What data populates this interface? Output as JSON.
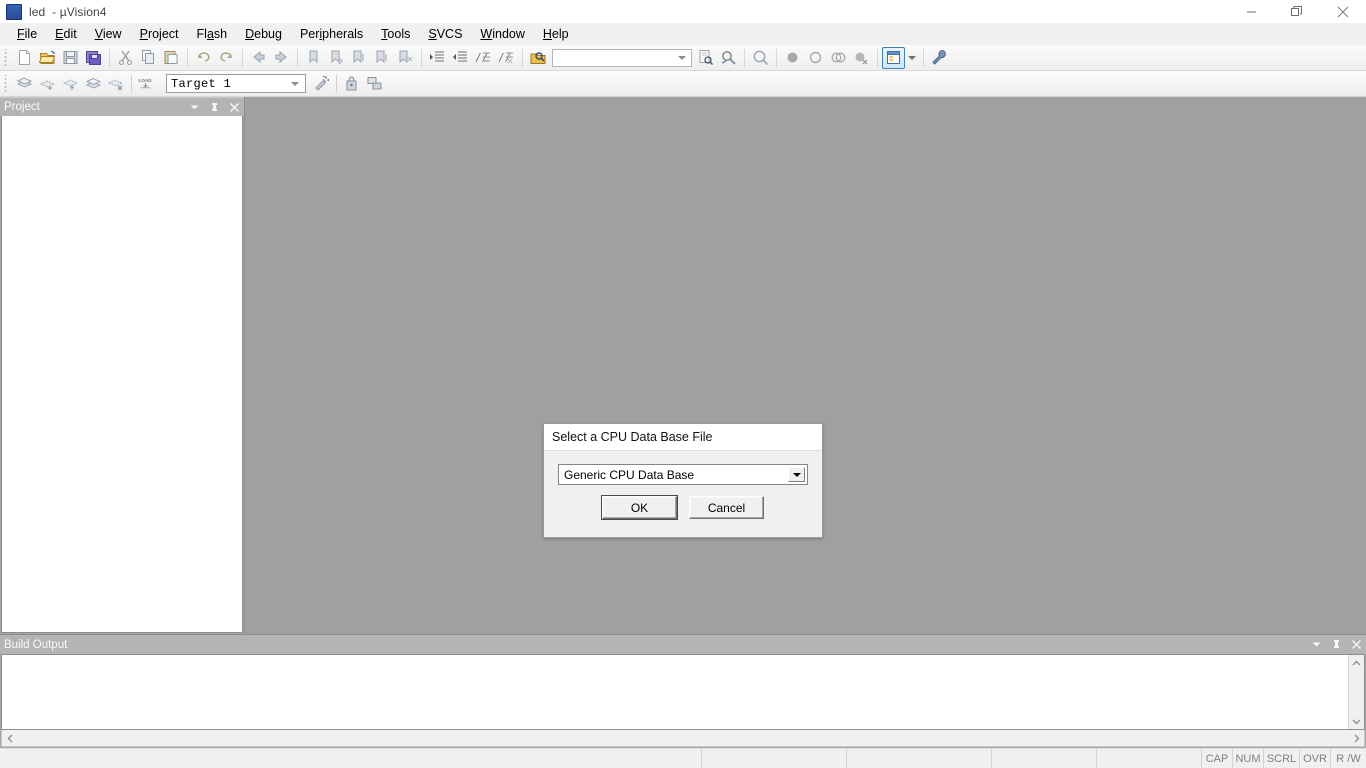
{
  "window": {
    "app_icon": "uvision-logo-icon",
    "title": "led  - µVision4",
    "controls": {
      "minimize": "minimize-icon",
      "maximize": "restore-icon",
      "close": "close-icon"
    }
  },
  "menubar": {
    "items": [
      {
        "label": "File",
        "mnemonic": "F"
      },
      {
        "label": "Edit",
        "mnemonic": "E"
      },
      {
        "label": "View",
        "mnemonic": "V"
      },
      {
        "label": "Project",
        "mnemonic": "P"
      },
      {
        "label": "Flash",
        "mnemonic": "a"
      },
      {
        "label": "Debug",
        "mnemonic": "D"
      },
      {
        "label": "Peripherals",
        "mnemonic": "i"
      },
      {
        "label": "Tools",
        "mnemonic": "T"
      },
      {
        "label": "SVCS",
        "mnemonic": "S"
      },
      {
        "label": "Window",
        "mnemonic": "W"
      },
      {
        "label": "Help",
        "mnemonic": "H"
      }
    ]
  },
  "toolbar_main": {
    "icons": [
      "new-file-icon",
      "open-file-icon",
      "save-icon",
      "save-all-icon",
      "cut-icon",
      "copy-icon",
      "paste-icon",
      "undo-icon",
      "redo-icon",
      "navigate-back-icon",
      "navigate-forward-icon",
      "back-to-last-bookmark-icon",
      "insert-bookmark-icon",
      "next-bookmark-icon",
      "previous-bookmark-icon",
      "clear-all-bookmarks-icon",
      "indent-icon",
      "outdent-icon",
      "comment-icon",
      "uncomment-icon",
      "find-in-files-icon"
    ],
    "find_combo": {
      "value": "",
      "placeholder": ""
    },
    "icons_right": [
      "find-icon",
      "incremental-find-icon",
      "zoom-icon",
      "breakpoint-icon",
      "disable-breakpoint-icon",
      "disable-all-breakpoints-icon",
      "kill-all-breakpoints-icon",
      "project-window-icon",
      "configuration-wizard-icon"
    ]
  },
  "toolbar_build": {
    "icons": [
      "translate-icon",
      "build-target-icon",
      "rebuild-all-icon",
      "batch-build-icon",
      "stop-build-icon",
      "download-icon"
    ],
    "target_select": {
      "value": "Target 1",
      "options": [
        "Target 1"
      ]
    },
    "icons_right": [
      "target-options-icon",
      "manage-components-icon",
      "manage-multi-project-icon"
    ]
  },
  "project_panel": {
    "title": "Project",
    "buttons": [
      "panel-menu-icon",
      "pin-icon",
      "close-icon"
    ],
    "content": ""
  },
  "build_output": {
    "title": "Build Output",
    "buttons": [
      "panel-menu-icon",
      "pin-icon",
      "close-icon"
    ],
    "content": "",
    "scroll": {
      "up": "scroll-up-icon",
      "down": "scroll-down-icon",
      "left": "scroll-left-icon",
      "right": "scroll-right-icon"
    }
  },
  "statusbar": {
    "message": "",
    "cells": [
      "",
      "",
      "",
      ""
    ],
    "flags": [
      "CAP",
      "NUM",
      "SCRL",
      "OVR",
      "R /W"
    ]
  },
  "dialog": {
    "title": "Select a CPU Data Base File",
    "database_select": {
      "value": "Generic CPU Data Base",
      "options": [
        "Generic CPU Data Base"
      ]
    },
    "ok_label": "OK",
    "cancel_label": "Cancel"
  },
  "colors": {
    "workspace_gray": "#a0a0a0",
    "panel_gray": "#b4b4b4",
    "toolbar_light": "#f0f0f0",
    "dialog_face": "#f0f0f0",
    "accent_blue": "#3c7fb1"
  }
}
